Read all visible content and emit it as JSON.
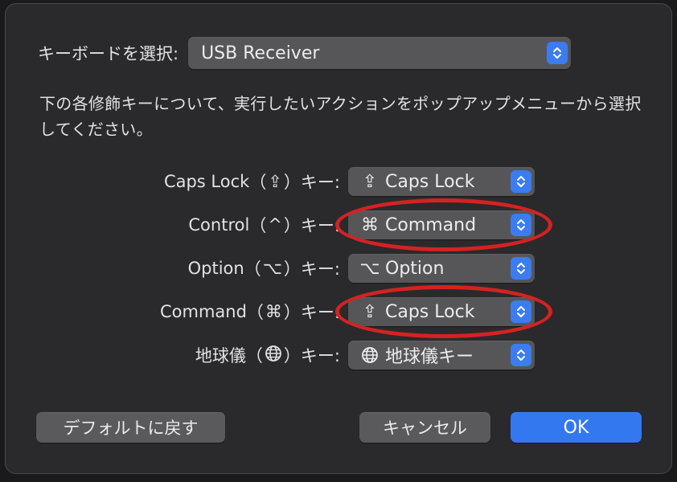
{
  "keyboard": {
    "label": "キーボードを選択:",
    "selected": "USB Receiver"
  },
  "description": "下の各修飾キーについて、実行したいアクションをポップアップメニューから選択してください。",
  "modifiers": [
    {
      "label_name": "Caps Lock",
      "label_glyph": "⇪",
      "label_suffix": "キー:",
      "value_glyph": "⇪",
      "value": "Caps Lock",
      "highlighted": false
    },
    {
      "label_name": "Control",
      "label_glyph": "^",
      "label_suffix": "キー:",
      "value_glyph": "⌘",
      "value": "Command",
      "highlighted": true
    },
    {
      "label_name": "Option",
      "label_glyph": "⌥",
      "label_suffix": "キー:",
      "value_glyph": "⌥",
      "value": "Option",
      "highlighted": false
    },
    {
      "label_name": "Command",
      "label_glyph": "⌘",
      "label_suffix": "キー:",
      "value_glyph": "⇪",
      "value": "Caps Lock",
      "highlighted": true
    },
    {
      "label_name": "地球儀",
      "label_glyph": "globe-icon",
      "label_suffix": "キー:",
      "value_glyph": "globe-icon",
      "value": "地球儀キー",
      "highlighted": false
    }
  ],
  "buttons": {
    "restore_defaults": "デフォルトに戻す",
    "cancel": "キャンセル",
    "ok": "OK"
  },
  "colors": {
    "accent": "#3478f0",
    "highlight_ring": "#d42222",
    "dialog_bg": "#2a2a2c",
    "popup_bg": "#565658"
  }
}
